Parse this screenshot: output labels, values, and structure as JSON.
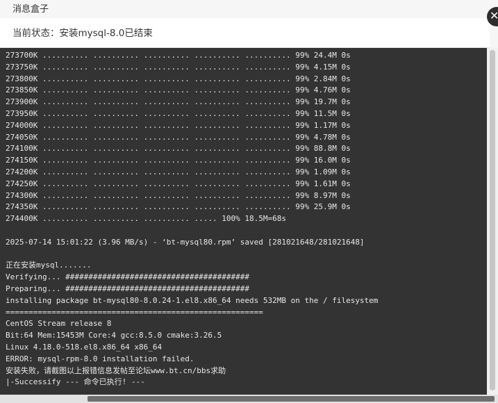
{
  "window": {
    "title": "消息盒子",
    "close_glyph": "✕",
    "close_icon": "close-icon"
  },
  "status": {
    "text": "当前状态：安装mysql-8.0已结束"
  },
  "console": {
    "lines": [
      "273700K .......... .......... .......... .......... .......... 99% 24.4M 0s",
      "273750K .......... .......... .......... .......... .......... 99% 4.15M 0s",
      "273800K .......... .......... .......... .......... .......... 99% 2.84M 0s",
      "273850K .......... .......... .......... .......... .......... 99% 4.76M 0s",
      "273900K .......... .......... .......... .......... .......... 99% 19.7M 0s",
      "273950K .......... .......... .......... .......... .......... 99% 11.5M 0s",
      "274000K .......... .......... .......... .......... .......... 99% 1.17M 0s",
      "274050K .......... .......... .......... .......... .......... 99% 4.78M 0s",
      "274100K .......... .......... .......... .......... .......... 99% 88.8M 0s",
      "274150K .......... .......... .......... .......... .......... 99% 16.0M 0s",
      "274200K .......... .......... .......... .......... .......... 99% 1.09M 0s",
      "274250K .......... .......... .......... .......... .......... 99% 1.61M 0s",
      "274300K .......... .......... .......... .......... .......... 99% 8.97M 0s",
      "274350K .......... .......... .......... .......... .......... 99% 25.9M 0s",
      "274400K .......... .......... .......... ..... 100% 18.5M=68s",
      "",
      "2025-07-14 15:01:22 (3.96 MB/s) - ‘bt-mysql80.rpm’ saved [281021648/281021648]",
      "",
      "正在安装mysql.......",
      "Verifying... ########################################",
      "Preparing... ########################################",
      "installing package bt-mysql80-8.0.24-1.el8.x86_64 needs 532MB on the / filesystem",
      "========================================================",
      "CentOS Stream release 8",
      "Bit:64 Mem:15453M Core:4 gcc:8.5.0 cmake:3.26.5",
      "Linux 4.18.0-518.el8.x86_64 x86_64",
      "ERROR: mysql-rpm-8.0 installation failed.",
      "安装失败，请截图以上报错信息发帖至论坛www.bt.cn/bbs求助",
      "|-Successify --- 命令已执行! ---"
    ]
  },
  "colors": {
    "console_background": "#333333",
    "console_text": "#e8e8e8",
    "header_background": "#f6f6f6",
    "status_background": "#ffffff"
  }
}
